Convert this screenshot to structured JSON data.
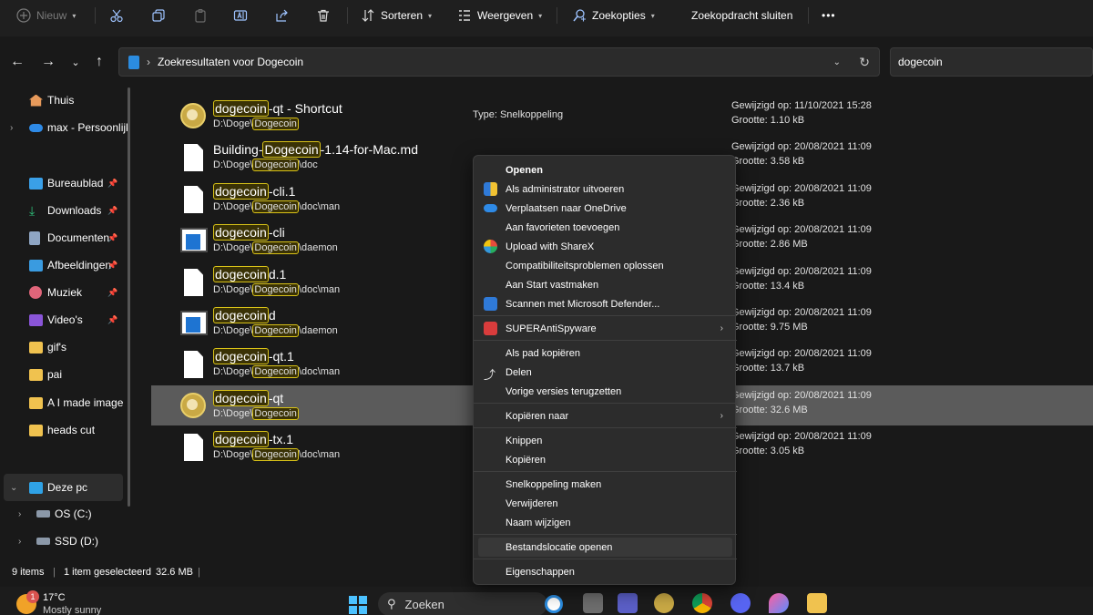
{
  "toolbar": {
    "new_label": "Nieuw",
    "sort_label": "Sorteren",
    "view_label": "Weergeven",
    "search_options_label": "Zoekopties",
    "close_search_label": "Zoekopdracht sluiten",
    "more_label": "•••"
  },
  "address": {
    "path": "Zoekresultaten voor Dogecoin",
    "search_value": "dogecoin"
  },
  "sidebar": {
    "items": [
      {
        "label": "Thuis",
        "icon": "home-icon"
      },
      {
        "label": "max - Persoonlijk",
        "icon": "onedrive-icon"
      },
      {
        "label": "Bureaublad",
        "icon": "desktop-icon"
      },
      {
        "label": "Downloads",
        "icon": "download-icon"
      },
      {
        "label": "Documenten",
        "icon": "documents-icon"
      },
      {
        "label": "Afbeeldingen",
        "icon": "pictures-icon"
      },
      {
        "label": "Muziek",
        "icon": "music-icon"
      },
      {
        "label": "Video's",
        "icon": "video-icon"
      },
      {
        "label": "gif's",
        "icon": "folder-icon"
      },
      {
        "label": "pai",
        "icon": "folder-icon"
      },
      {
        "label": "A I made image",
        "icon": "folder-icon"
      },
      {
        "label": "heads cut",
        "icon": "folder-icon"
      },
      {
        "label": "Deze pc",
        "icon": "pc-icon"
      },
      {
        "label": "OS (C:)",
        "icon": "drive-icon"
      },
      {
        "label": "SSD (D:)",
        "icon": "drive-icon"
      }
    ]
  },
  "files": [
    {
      "pre": "",
      "hl": "dogecoin",
      "post": "-qt - Shortcut",
      "path_pre": "D:\\Doge\\",
      "path_hl": "Dogecoin",
      "path_post": "",
      "type": "Type: Snelkoppeling",
      "modified": "Gewijzigd op: 11/10/2021 15:28",
      "size": "Grootte: 1.10 kB",
      "icon": "shortcut-coin-icon"
    },
    {
      "pre": "Building-",
      "hl": "Dogecoin",
      "post": "-1.14-for-Mac.md",
      "path_pre": "D:\\Doge\\",
      "path_hl": "Dogecoin",
      "path_post": "\\doc",
      "type": "",
      "modified": "Gewijzigd op: 20/08/2021 11:09",
      "size": "Grootte: 3.58 kB",
      "icon": "document-icon"
    },
    {
      "pre": "",
      "hl": "dogecoin",
      "post": "-cli.1",
      "path_pre": "D:\\Doge\\",
      "path_hl": "Dogecoin",
      "path_post": "\\doc\\man",
      "type": "",
      "modified": "Gewijzigd op: 20/08/2021 11:09",
      "size": "Grootte: 2.36 kB",
      "icon": "document-icon"
    },
    {
      "pre": "",
      "hl": "dogecoin",
      "post": "-cli",
      "path_pre": "D:\\Doge\\",
      "path_hl": "Dogecoin",
      "path_post": "\\daemon",
      "type": "",
      "modified": "Gewijzigd op: 20/08/2021 11:09",
      "size": "Grootte: 2.86 MB",
      "icon": "application-icon"
    },
    {
      "pre": "",
      "hl": "dogecoin",
      "post": "d.1",
      "path_pre": "D:\\Doge\\",
      "path_hl": "Dogecoin",
      "path_post": "\\doc\\man",
      "type": "",
      "modified": "Gewijzigd op: 20/08/2021 11:09",
      "size": "Grootte: 13.4 kB",
      "icon": "document-icon"
    },
    {
      "pre": "",
      "hl": "dogecoin",
      "post": "d",
      "path_pre": "D:\\Doge\\",
      "path_hl": "Dogecoin",
      "path_post": "\\daemon",
      "type": "",
      "modified": "Gewijzigd op: 20/08/2021 11:09",
      "size": "Grootte: 9.75 MB",
      "icon": "application-icon"
    },
    {
      "pre": "",
      "hl": "dogecoin",
      "post": "-qt.1",
      "path_pre": "D:\\Doge\\",
      "path_hl": "Dogecoin",
      "path_post": "\\doc\\man",
      "type": "",
      "modified": "Gewijzigd op: 20/08/2021 11:09",
      "size": "Grootte: 13.7 kB",
      "icon": "document-icon"
    },
    {
      "pre": "",
      "hl": "dogecoin",
      "post": "-qt",
      "path_pre": "D:\\Doge\\",
      "path_hl": "Dogecoin",
      "path_post": "",
      "type": "",
      "modified": "Gewijzigd op: 20/08/2021 11:09",
      "size": "Grootte: 32.6 MB",
      "icon": "coin-icon"
    },
    {
      "pre": "",
      "hl": "dogecoin",
      "post": "-tx.1",
      "path_pre": "D:\\Doge\\",
      "path_hl": "Dogecoin",
      "path_post": "\\doc\\man",
      "type": "",
      "modified": "Gewijzigd op: 20/08/2021 11:09",
      "size": "Grootte: 3.05 kB",
      "icon": "document-icon"
    }
  ],
  "context_menu": {
    "items": [
      {
        "label": "Openen",
        "icon": "",
        "bold": true
      },
      {
        "label": "Als administrator uitvoeren",
        "icon": "uac-shield-icon"
      },
      {
        "label": "Verplaatsen naar OneDrive",
        "icon": "onedrive-icon"
      },
      {
        "label": "Aan favorieten toevoegen",
        "icon": ""
      },
      {
        "label": "Upload with ShareX",
        "icon": "sharex-icon"
      },
      {
        "label": "Compatibiliteitsproblemen oplossen",
        "icon": ""
      },
      {
        "label": "Aan Start vastmaken",
        "icon": ""
      },
      {
        "label": "Scannen met Microsoft Defender...",
        "icon": "defender-icon"
      },
      {
        "label": "SUPERAntiSpyware",
        "icon": "superantispyware-icon",
        "arrow": true
      },
      {
        "label": "Als pad kopiëren",
        "icon": ""
      },
      {
        "label": "Delen",
        "icon": "share-icon"
      },
      {
        "label": "Vorige versies terugzetten",
        "icon": ""
      },
      {
        "label": "Kopiëren naar",
        "icon": "",
        "arrow": true
      },
      {
        "label": "Knippen",
        "icon": ""
      },
      {
        "label": "Kopiëren",
        "icon": ""
      },
      {
        "label": "Snelkoppeling maken",
        "icon": ""
      },
      {
        "label": "Verwijderen",
        "icon": ""
      },
      {
        "label": "Naam wijzigen",
        "icon": ""
      },
      {
        "label": "Bestandslocatie openen",
        "icon": "",
        "hover": true
      },
      {
        "label": "Eigenschappen",
        "icon": ""
      }
    ]
  },
  "status": {
    "count": "9 items",
    "selected": "1 item geselecteerd",
    "size": "32.6 MB"
  },
  "taskbar": {
    "weather_temp": "17°C",
    "weather_desc": "Mostly sunny",
    "weather_badge": "1",
    "search_label": "Zoeken"
  },
  "colors": {
    "highlight_border": "#d8c218",
    "selection_bg": "#5b5b5b",
    "accent_blue": "#1e74d2"
  }
}
